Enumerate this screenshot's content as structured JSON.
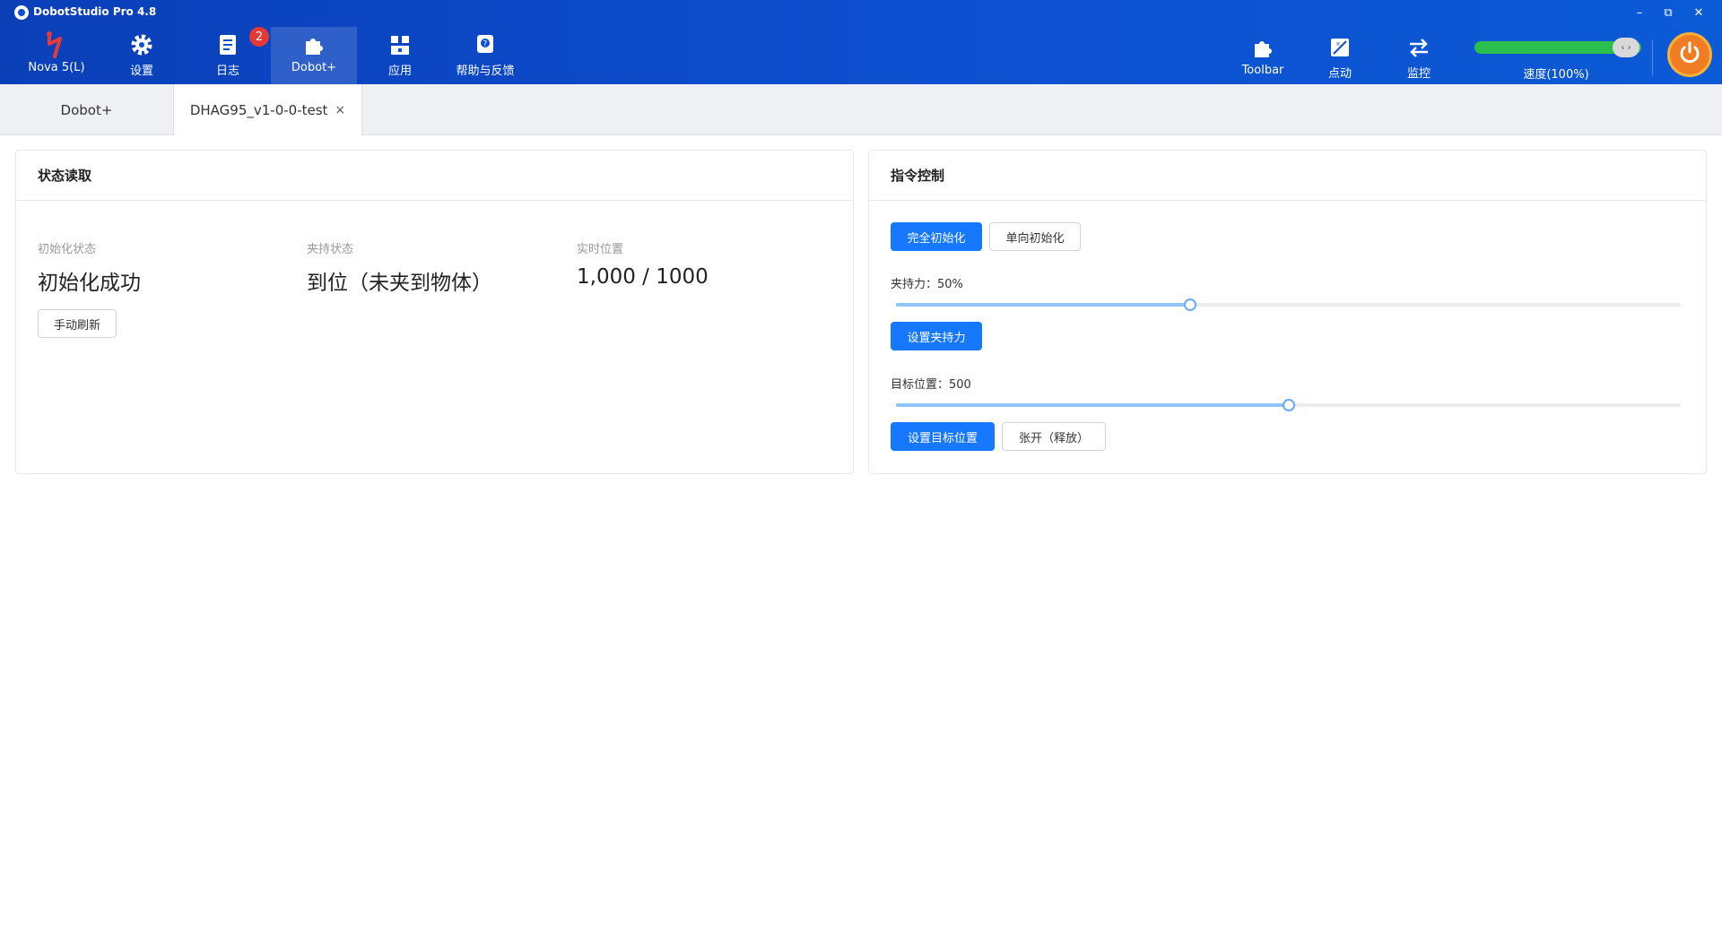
{
  "window": {
    "title": "DobotStudio Pro 4.8",
    "controls": {
      "minimize": "–",
      "restore": "⧉",
      "close": "✕"
    }
  },
  "nav": {
    "robot": "Nova 5(L)",
    "settings": "设置",
    "log": "日志",
    "log_badge": "2",
    "dobot_plus": "Dobot+",
    "apps": "应用",
    "help": "帮助与反馈",
    "toolbar": "Toolbar",
    "jog": "点动",
    "monitor": "监控",
    "speed_label": "速度(100%)",
    "speed_knob": "‹ ›",
    "speed_fraction": 1.0
  },
  "tabs": {
    "items": [
      "Dobot+",
      "DHAG95_v1-0-0-test"
    ],
    "close_glyph": "×"
  },
  "status_panel": {
    "title": "状态读取",
    "init_label": "初始化状态",
    "init_value": "初始化成功",
    "grip_label": "夹持状态",
    "grip_value": "到位（未夹到物体）",
    "pos_label": "实时位置",
    "pos_value": "1,000 / 1000",
    "refresh_button": "手动刷新"
  },
  "command_panel": {
    "title": "指令控制",
    "full_init_button": "完全初始化",
    "single_init_button": "单向初始化",
    "force_label": "夹持力：50%",
    "force_fraction": 0.375,
    "set_force_button": "设置夹持力",
    "target_label": "目标位置：500",
    "target_fraction": 0.5,
    "set_target_button": "设置目标位置",
    "open_button": "张开（释放）"
  },
  "colors": {
    "header_blue": "#0d4fd0",
    "primary": "#1677ff",
    "badge_red": "#e53935",
    "speed_green": "#2bbf4e",
    "power_orange": "#f07c23"
  }
}
